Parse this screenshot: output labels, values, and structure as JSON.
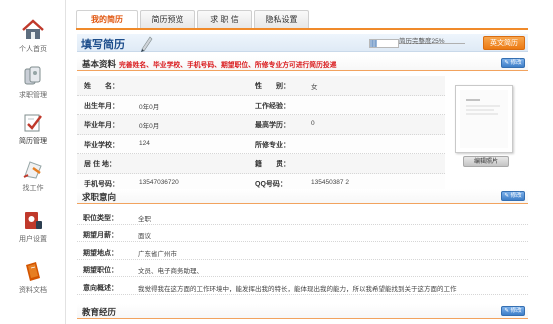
{
  "sidebar": {
    "items": [
      {
        "label": "个人首页",
        "icon": "home-icon"
      },
      {
        "label": "求职管理",
        "icon": "briefcase-icon"
      },
      {
        "label": "简历管理",
        "icon": "resume-icon"
      },
      {
        "label": "找工作",
        "icon": "search-job-icon"
      },
      {
        "label": "用户设置",
        "icon": "user-settings-icon"
      },
      {
        "label": "资料文档",
        "icon": "document-icon"
      }
    ]
  },
  "tabs": [
    {
      "label": "我的简历",
      "active": true
    },
    {
      "label": "简历预览",
      "active": false
    },
    {
      "label": "求 职 信",
      "active": false
    },
    {
      "label": "隐私设置",
      "active": false
    }
  ],
  "header": {
    "title": "填写简历",
    "progress_text": "简历完整度25%",
    "progress_percent": 25,
    "english_button": "英文简历"
  },
  "basic": {
    "title": "基本资料",
    "note": "完善姓名、毕业学校、手机号码、期望职位、所修专业方可进行简历投递",
    "edit_label": "修改",
    "rows": [
      {
        "l1": "姓　　名：",
        "v1": "",
        "l2": "性　　别：",
        "v2": "女"
      },
      {
        "l1": "出生年月：",
        "v1": "0年0月",
        "l2": "工作经验：",
        "v2": ""
      },
      {
        "l1": "毕业年月：",
        "v1": "0年0月",
        "l2": "最高学历：",
        "v2": "0"
      },
      {
        "l1": "毕业学校：",
        "v1": "124",
        "l2": "所修专业：",
        "v2": ""
      },
      {
        "l1": "居 住 地：",
        "v1": "",
        "l2": "籍　　贯：",
        "v2": ""
      },
      {
        "l1": "手机号码：",
        "v1": "13547036720",
        "l2": "QQ号码：",
        "v2": "135450387 2"
      }
    ],
    "photo_button": "编辑照片"
  },
  "intent": {
    "title": "求职意向",
    "edit_label": "修改",
    "rows": [
      {
        "label": "职位类型：",
        "value": "全职"
      },
      {
        "label": "期望月薪：",
        "value": "面议"
      },
      {
        "label": "期望地点：",
        "value": "广东省广州市"
      },
      {
        "label": "期望职位：",
        "value": "文员、电子商务助理、"
      },
      {
        "label": "意向概述：",
        "value": "我觉得我在这方面的工作环境中，能发挥出我的特长，能体现出我的能力，所以我希望能找到关于这方面的工作"
      }
    ]
  },
  "education": {
    "title": "教育经历",
    "edit_label": "修改"
  },
  "colors": {
    "accent": "#f08a2a",
    "title_blue": "#1f4f8c",
    "note_red": "#d9191c"
  }
}
